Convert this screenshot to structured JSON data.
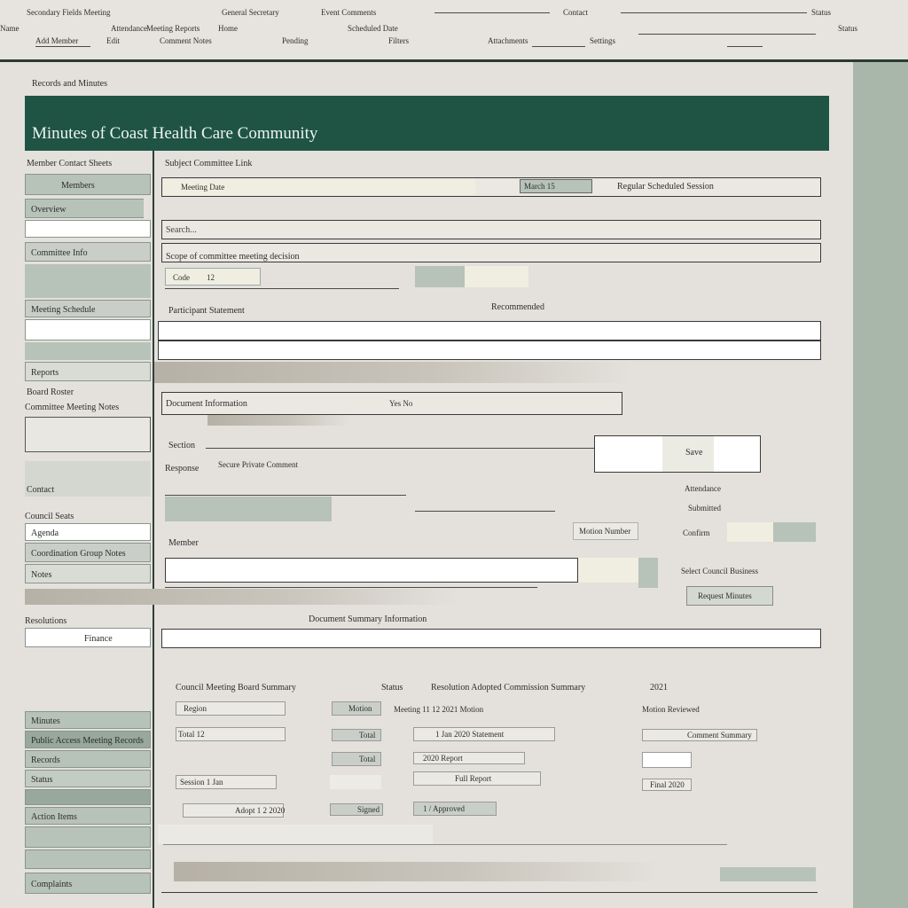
{
  "app": {
    "title": "Minutes of Coast Health Care Community",
    "breadcrumb": "Records and Minutes"
  },
  "colors": {
    "banner": "#1f5445",
    "sage": "#b7c2b9",
    "sage_dark": "#98a89c",
    "rail": "#a9b7ab",
    "cream": "#efeee0",
    "background": "#e4e1dc"
  },
  "topbar": {
    "row1": [
      "Secondary Fields Meeting",
      "General Secretary",
      "Event Comments",
      "Contact",
      "Status",
      "Add Member",
      "Pending"
    ],
    "row2": [
      "Name",
      "Attendance",
      "Meeting Reports",
      "Home",
      "Scheduled Date",
      "Edit",
      "Comment Notes",
      "Filters",
      "Attachments",
      "Settings",
      "Status"
    ]
  },
  "sidebar": {
    "heading": "Member Contact Sheets",
    "items": [
      {
        "label": "Members"
      },
      {
        "label": "Overview"
      },
      {
        "label": "Committee Info"
      },
      {
        "label": "Meeting Schedule"
      },
      {
        "label": "Reports"
      },
      {
        "label": "Board Roster"
      },
      {
        "label": "Committee Meeting Notes"
      },
      {
        "label": "Contact"
      },
      {
        "label": "Council Seats"
      },
      {
        "label": "Agenda"
      },
      {
        "label": "Coordination Group Notes"
      },
      {
        "label": "Notes"
      }
    ],
    "bottom_items": [
      {
        "label": "Resolutions"
      },
      {
        "label": "Finance"
      },
      {
        "label": "Minutes"
      },
      {
        "label": "Public Access Meeting Records"
      },
      {
        "label": "Records"
      },
      {
        "label": "Status"
      },
      {
        "label": "Action Items"
      },
      {
        "label": "Complaints"
      }
    ]
  },
  "form": {
    "section_title": "Subject Committee Link",
    "date_label": "Meeting Date",
    "date_value": "March 15",
    "selected_value": "Regular Scheduled Session",
    "search_placeholder": "Search...",
    "scheduled_label": "Scope of committee meeting decision",
    "code_label": "Code",
    "code_value": "12",
    "type_label": "Participant Statement",
    "type_option": "Recommended",
    "dropdown_value": "Document Information",
    "dropdown_alt": "Yes No",
    "section_label": "Section",
    "response_label": "Response",
    "response_text": "Secure Private Comment",
    "save_label": "Save",
    "attendance_label": "Attendance",
    "submitted_label": "Submitted",
    "field_label": "Motion Number",
    "confirm_label": "Confirm",
    "field_value": "Member",
    "select_label": "Select Council Business",
    "action_button": "Request Minutes",
    "final_label": "Document Summary Information"
  },
  "table": {
    "header": "Council Meeting Board Summary",
    "col2": "Status",
    "col3": "Resolution Adopted Commission Summary",
    "col4": "2021",
    "rows": [
      {
        "c1": "Region",
        "c2": "Motion",
        "c3": "Meeting 11 12 2021 Motion",
        "c4": "Motion Reviewed"
      },
      {
        "c1": "Total 12",
        "c2": "Total",
        "c3": "1 Jan 2020 Statement",
        "c4": "Comment Summary"
      },
      {
        "c1": "",
        "c2": "Total",
        "c3": "2020 Report",
        "c4": ""
      },
      {
        "c1": "Session 1 Jan",
        "c2": "",
        "c3": "Full Report",
        "c4": "Final 2020"
      },
      {
        "c1": "Adopt 1 2 2020",
        "c2": "Signed",
        "c3": "1 / Approved",
        "c4": ""
      }
    ]
  }
}
